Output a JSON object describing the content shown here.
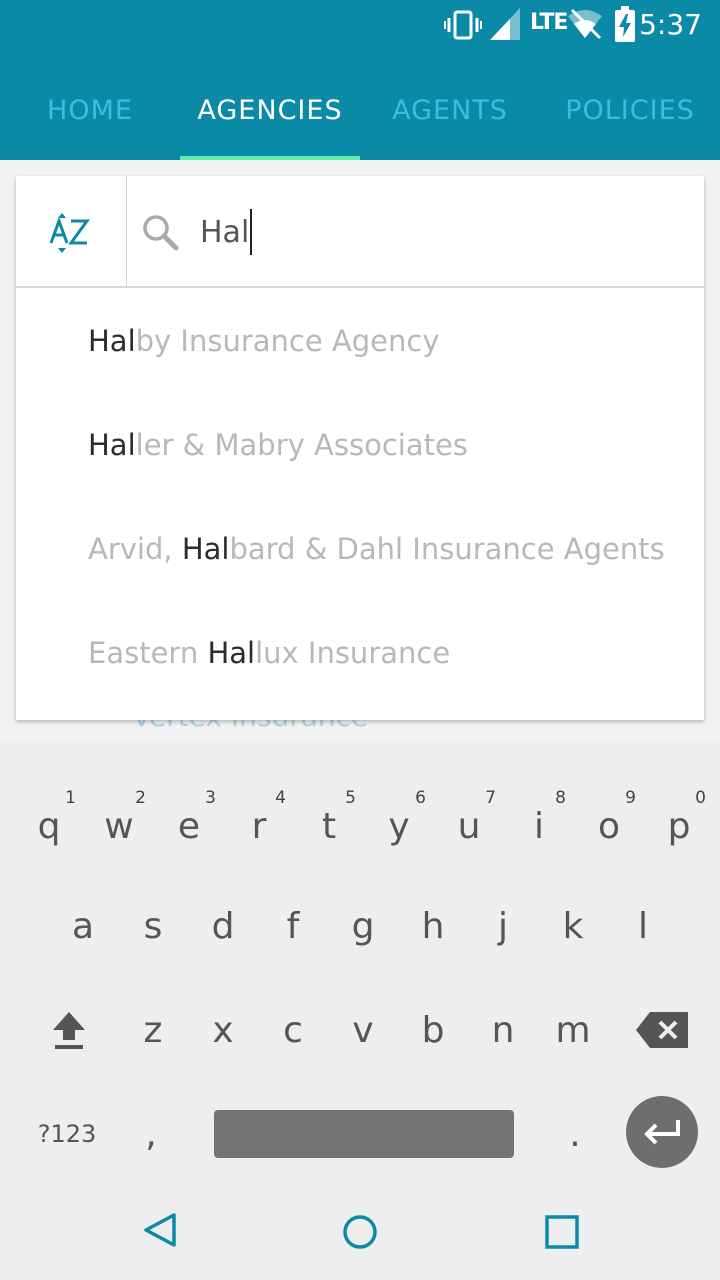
{
  "status": {
    "network": "LTE",
    "time": "5:37"
  },
  "tabs": [
    {
      "label": "HOME",
      "active": false
    },
    {
      "label": "AGENCIES",
      "active": true
    },
    {
      "label": "AGENTS",
      "active": false
    },
    {
      "label": "POLICIES",
      "active": false
    }
  ],
  "search": {
    "value": "Hal",
    "sort_icon": "sort-az-icon",
    "search_icon": "search-icon"
  },
  "suggestions": [
    {
      "pre": "",
      "hl": "Hal",
      "post": "by Insurance Agency"
    },
    {
      "pre": "",
      "hl": "Hal",
      "post": "ler & Mabry Associates"
    },
    {
      "pre": "Arvid, ",
      "hl": "Hal",
      "post": "bard & Dahl Insurance Agents"
    },
    {
      "pre": "Eastern ",
      "hl": "Hal",
      "post": "lux Insurance"
    }
  ],
  "background_item": "Vertex Insurance",
  "keyboard": {
    "row1": [
      {
        "k": "q",
        "h": "1"
      },
      {
        "k": "w",
        "h": "2"
      },
      {
        "k": "e",
        "h": "3"
      },
      {
        "k": "r",
        "h": "4"
      },
      {
        "k": "t",
        "h": "5"
      },
      {
        "k": "y",
        "h": "6"
      },
      {
        "k": "u",
        "h": "7"
      },
      {
        "k": "i",
        "h": "8"
      },
      {
        "k": "o",
        "h": "9"
      },
      {
        "k": "p",
        "h": "0"
      }
    ],
    "row2": [
      "a",
      "s",
      "d",
      "f",
      "g",
      "h",
      "j",
      "k",
      "l"
    ],
    "row3": [
      "z",
      "x",
      "c",
      "v",
      "b",
      "n",
      "m"
    ],
    "symbols_label": "?123",
    "comma": ",",
    "period": "."
  },
  "colors": {
    "appbar": "#0a8aa6",
    "tab_active": "#ffffff",
    "tab_inactive": "#35c0dc",
    "indicator": "#5ef0a8",
    "accent": "#0a8aa6"
  }
}
